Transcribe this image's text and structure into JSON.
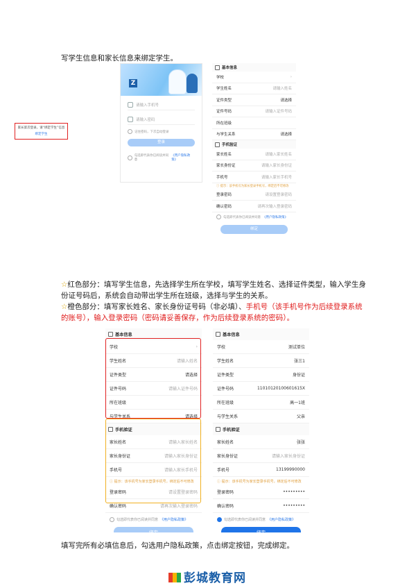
{
  "intro": "写学生信息和家长信息来绑定学生。",
  "notes": {
    "red_prefix": "☆",
    "red_text": "红色部分：填写学生信息，先选择学生所在学校，填写学生姓名、选择证件类型，输入学生身份证号码后，系统会自动带出学生所在班级，选择与学生的关系。",
    "orange_prefix": "☆",
    "orange_text_a": "橙色部分：填写家长姓名、家长身份证号码（非必填）、",
    "orange_text_red": "手机号（该手机号作为后续登录系统的账号），输入登录密码（密码请妥善保存，作为后续登录系统的密码）。"
  },
  "outro": "填写完所有必填信息后，勾选用户隐私政策，点击绑定按钮，完成绑定。",
  "login": {
    "account_placeholder": "请输入手机号",
    "password_placeholder": "请输入密码",
    "remember": "记住密码，下次自动登录",
    "login_button": "登录",
    "agree_text": "勾选即代表你已阅读并同意",
    "agree_link": "《用户隐私政策》",
    "bind_prompt": "家长第次登录，请“绑定学生”信息",
    "bind_link": "绑定学生"
  },
  "form": {
    "section_basic": "基本信息",
    "section_phone": "手机验证",
    "labels": {
      "school": "学校",
      "student_name": "学生姓名",
      "id_type": "证件类型",
      "id_no": "证件号码",
      "class": "所在班级",
      "relation": "与学生关系",
      "parent_name": "家长姓名",
      "parent_id": "家长身份证",
      "phone": "手机号",
      "password": "登录密码",
      "confirm": "确认密码"
    },
    "placeholders": {
      "student_name": "请输入姓名",
      "select": "请选择",
      "id_no": "请输入证件号码",
      "parent_name": "请输入家长姓名",
      "parent_id": "请输入家长身份证",
      "phone": "请输入家长手机号",
      "password": "请设置登录密码",
      "confirm": "请再次输入登录密码"
    },
    "hint": "ⓘ 提示：该手机号为家长登录手机号，绑定后不可修改",
    "agree_text": "勾选即代表你已阅读并同意",
    "agree_link": "《用户隐私政策》",
    "bind_button": "绑定",
    "filled": {
      "school": "测试单位",
      "student_name": "张三1",
      "id_type": "身份证",
      "id_no": "11010120100601615X",
      "class": "高一1班",
      "relation": "父亲",
      "parent_name": "张张",
      "phone": "13199990000",
      "password": "•••••••••",
      "confirm": "•••••••••"
    }
  },
  "brand": {
    "name": "彭城教育网"
  },
  "colors": {
    "red": "#e02020",
    "orange": "#f0b020",
    "primary": "#1f74e8"
  }
}
